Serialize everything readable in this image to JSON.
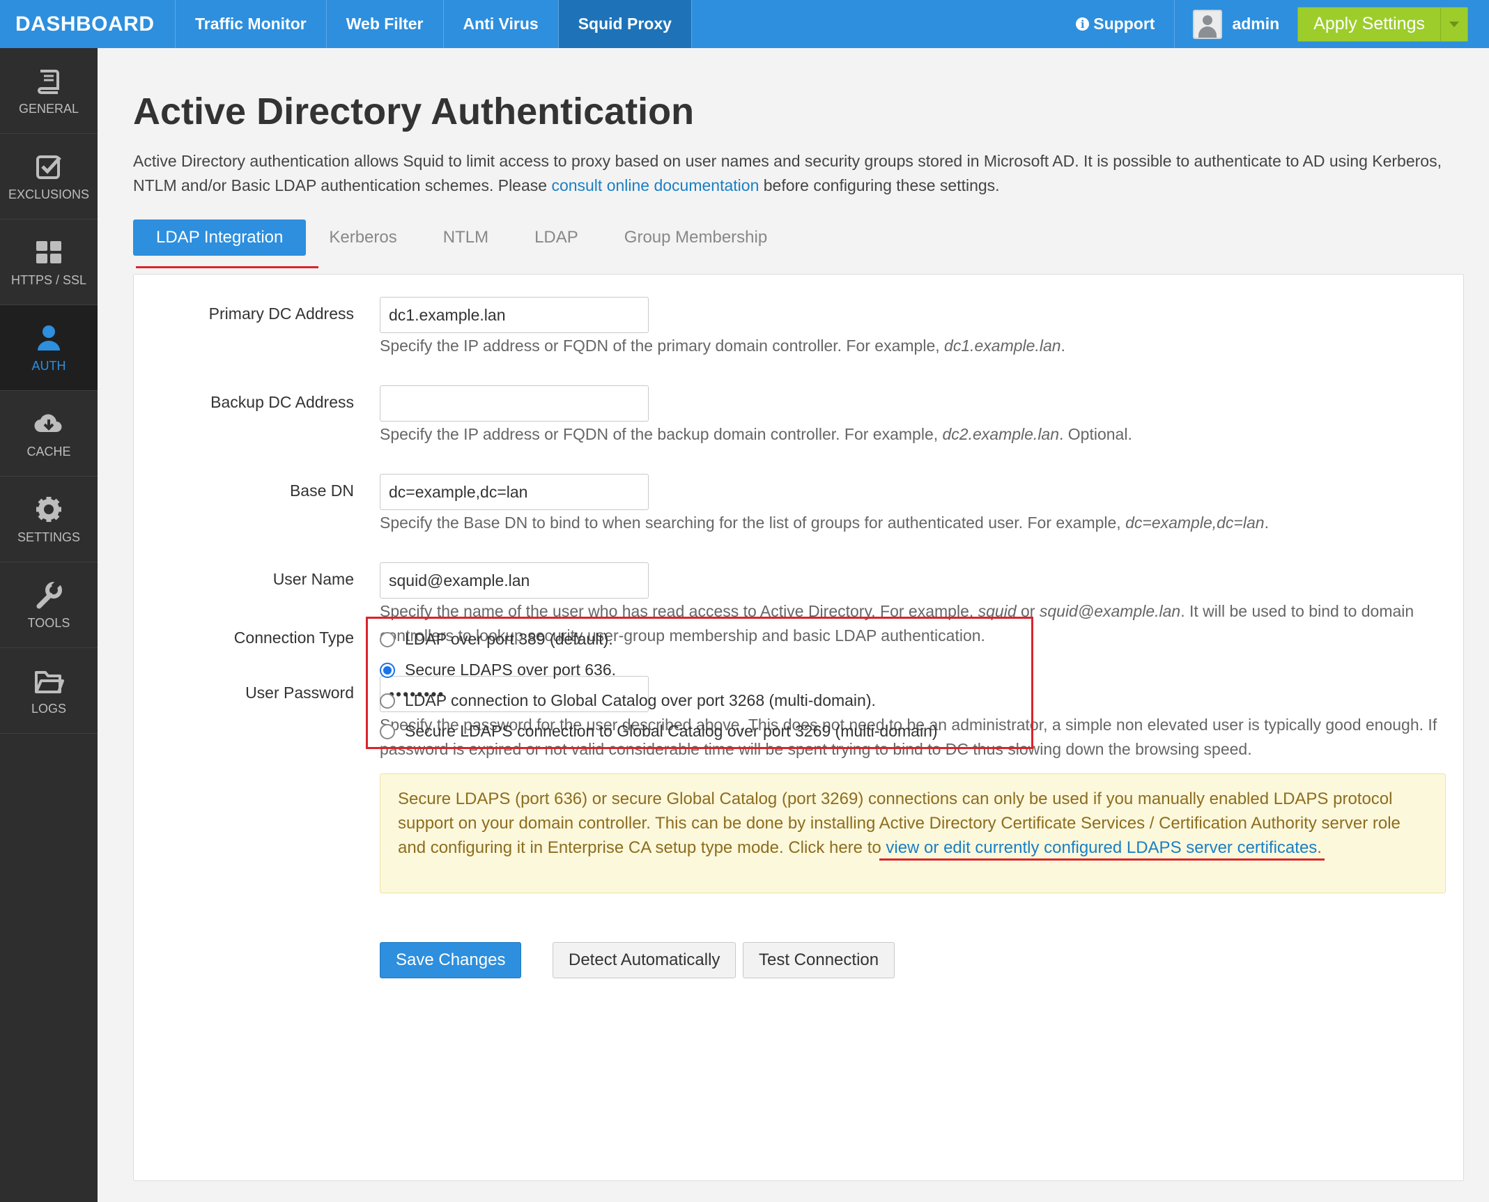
{
  "brand": "DASHBOARD",
  "topnav": [
    {
      "label": "Traffic Monitor"
    },
    {
      "label": "Web Filter"
    },
    {
      "label": "Anti Virus"
    },
    {
      "label": "Squid Proxy"
    }
  ],
  "support_label": "Support",
  "user_label": "admin",
  "apply_label": "Apply Settings",
  "sidebar": [
    {
      "label": "GENERAL",
      "icon": "book-icon"
    },
    {
      "label": "EXCLUSIONS",
      "icon": "checkbox-icon"
    },
    {
      "label": "HTTPS / SSL",
      "icon": "grid-icon"
    },
    {
      "label": "AUTH",
      "icon": "user-icon"
    },
    {
      "label": "CACHE",
      "icon": "cloud-download-icon"
    },
    {
      "label": "SETTINGS",
      "icon": "gear-icon"
    },
    {
      "label": "TOOLS",
      "icon": "wrench-icon"
    },
    {
      "label": "LOGS",
      "icon": "folder-icon"
    }
  ],
  "page": {
    "title": "Active Directory Authentication",
    "desc_before": "Active Directory authentication allows Squid to limit access to proxy based on user names and security groups stored in Microsoft AD. It is possible to authenticate to AD using Kerberos, NTLM and/or Basic LDAP authentication schemes. Please ",
    "desc_link": "consult online documentation",
    "desc_after": " before configuring these settings."
  },
  "tabs": [
    {
      "label": "LDAP Integration"
    },
    {
      "label": "Kerberos"
    },
    {
      "label": "NTLM"
    },
    {
      "label": "LDAP"
    },
    {
      "label": "Group Membership"
    }
  ],
  "form": {
    "primary_dc": {
      "label": "Primary DC Address",
      "value": "dc1.example.lan",
      "help_before": "Specify the IP address or FQDN of the primary domain controller. For example, ",
      "help_em": "dc1.example.lan",
      "help_after": "."
    },
    "backup_dc": {
      "label": "Backup DC Address",
      "value": "",
      "help_before": "Specify the IP address or FQDN of the backup domain controller. For example, ",
      "help_em": "dc2.example.lan",
      "help_after": ". Optional."
    },
    "base_dn": {
      "label": "Base DN",
      "value": "dc=example,dc=lan",
      "help_before": "Specify the Base DN to bind to when searching for the list of groups for authenticated user. For example, ",
      "help_em": "dc=example,dc=lan",
      "help_after": "."
    },
    "user_name": {
      "label": "User Name",
      "value": "squid@example.lan",
      "help_before": "Specify the name of the user who has read access to Active Directory. For example, ",
      "help_em1": "squid",
      "help_mid": " or ",
      "help_em2": "squid@example.lan",
      "help_after": ". It will be used to bind to domain controllers to lookup security user-group membership and basic LDAP authentication."
    },
    "user_password": {
      "label": "User Password",
      "value": "••••••••",
      "help": "Specify the password for the user described above. This does not need to be an administrator, a simple non elevated user is typically good enough. If password is expired or not valid considerable time will be spent trying to bind to DC thus slowing down the browsing speed."
    },
    "connection_type": {
      "label": "Connection Type",
      "options": [
        {
          "label": "LDAP over port 389 (default).",
          "checked": false
        },
        {
          "label": "Secure LDAPS over port 636.",
          "checked": true
        },
        {
          "label": "LDAP connection to Global Catalog over port 3268 (multi-domain).",
          "checked": false
        },
        {
          "label": "Secure LDAPS connection to Global Catalog over port 3269 (multi-domain)",
          "checked": false
        }
      ]
    }
  },
  "alert": {
    "text": "Secure LDAPS (port 636) or secure Global Catalog (port 3269) connections can only be used if you manually enabled LDAPS protocol support on your domain controller. This can be done by installing Active Directory Certificate Services / Certification Authority server role and configuring it in Enterprise CA setup type mode. Click here to ",
    "link": "view or edit currently configured LDAPS server certificates",
    "after": "."
  },
  "buttons": {
    "save": "Save Changes",
    "detect": "Detect Automatically",
    "test": "Test Connection"
  },
  "colors": {
    "topbar": "#2d8fde",
    "sidebar": "#2e2e2e",
    "apply": "#9ccd2b",
    "highlight": "#d9252b"
  }
}
